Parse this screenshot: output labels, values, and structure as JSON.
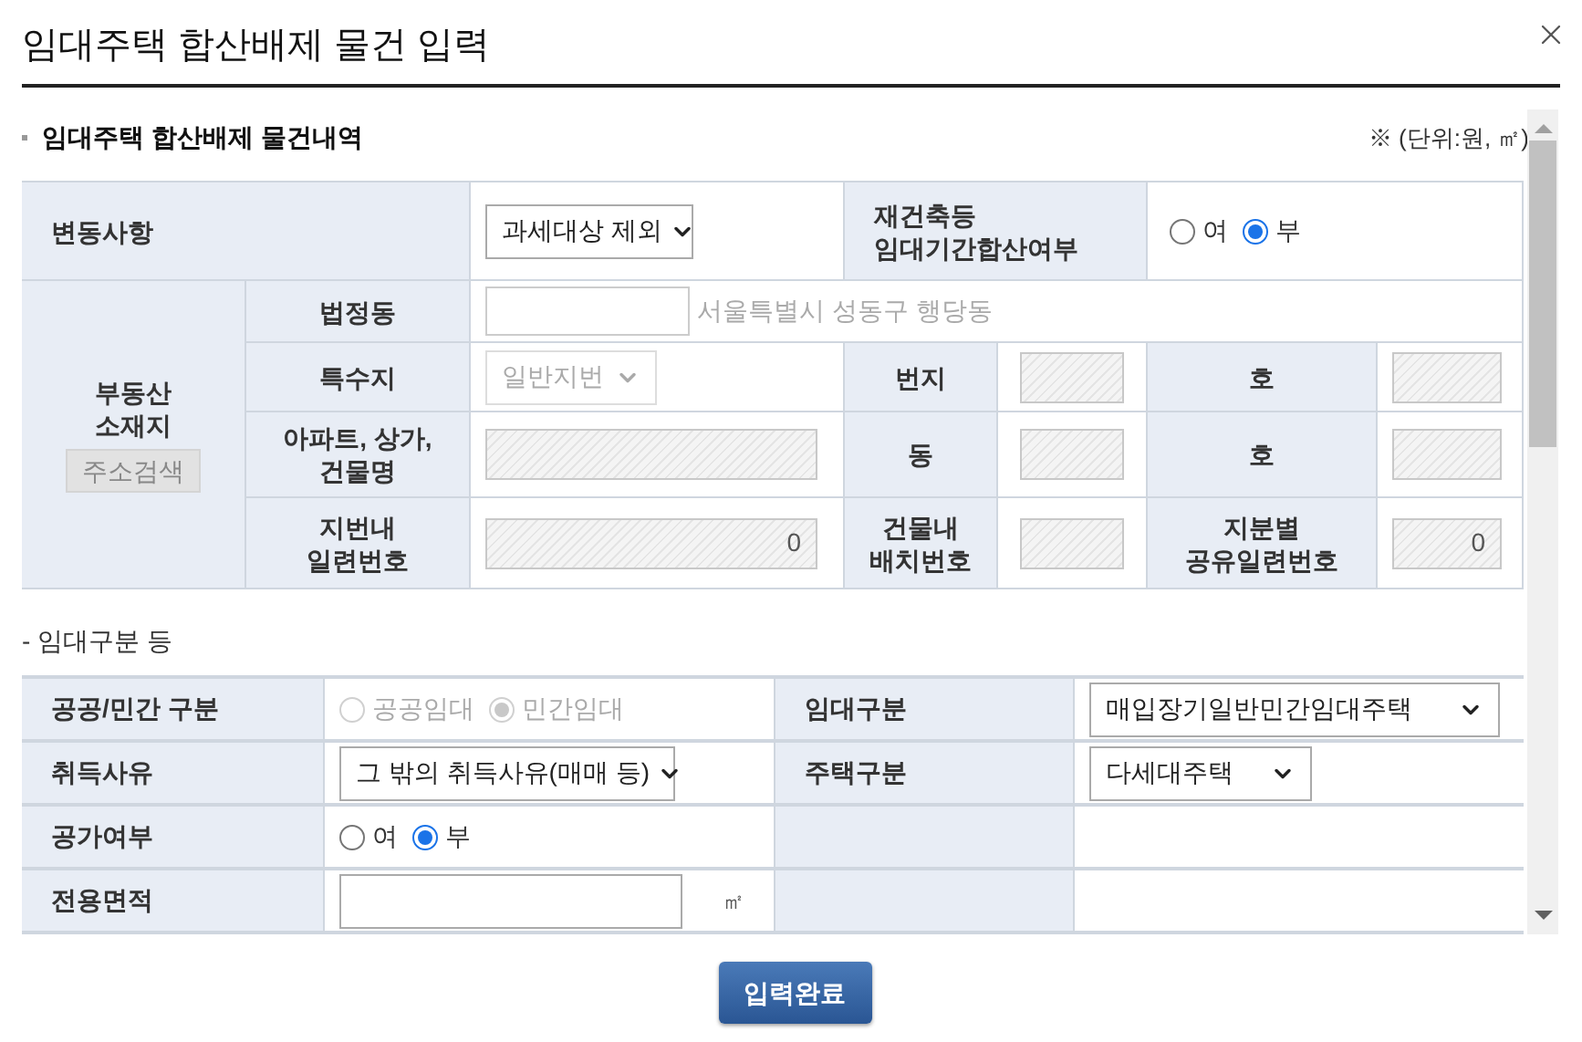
{
  "dialog": {
    "title": "임대주택 합산배제 물건 입력"
  },
  "section": {
    "title": "임대주택 합산배제 물건내역",
    "unit_note": "※ (단위:원, ㎡)"
  },
  "property_table": {
    "change": {
      "label": "변동사항",
      "value": "과세대상 제외"
    },
    "merge": {
      "label": "재건축등\n임대기간합산여부",
      "options": [
        {
          "label": "여",
          "selected": false
        },
        {
          "label": "부",
          "selected": true
        }
      ]
    },
    "location": {
      "label": "부동산\n소재지",
      "search_button": "주소검색"
    },
    "legal_dong": {
      "label": "법정동",
      "address": "서울특별시 성동구 행당동"
    },
    "special_lot": {
      "label": "특수지",
      "value": "일반지번",
      "disabled": true
    },
    "lot_number": {
      "label": "번지"
    },
    "lot_sub": {
      "label": "호"
    },
    "building_name": {
      "label": "아파트, 상가,\n건물명"
    },
    "building_dong": {
      "label": "동"
    },
    "building_ho": {
      "label": "호"
    },
    "lot_serial": {
      "label": "지번내\n일련번호",
      "value": "0"
    },
    "placement_number": {
      "label": "건물내\n배치번호"
    },
    "share_serial": {
      "label": "지분별\n공유일련번호",
      "value": "0"
    }
  },
  "rental_section": {
    "title": "- 임대구분 등",
    "rows": [
      [
        {
          "label": "공공/민간 구분",
          "kind": "radio",
          "disabled": true,
          "options": [
            {
              "label": "공공임대",
              "selected": false
            },
            {
              "label": "민간임대",
              "selected": true
            }
          ]
        },
        {
          "label": "임대구분",
          "kind": "select",
          "value": "매입장기일반민간임대주택"
        }
      ],
      [
        {
          "label": "취득사유",
          "kind": "select",
          "value": "그 밖의 취득사유(매매 등)"
        },
        {
          "label": "주택구분",
          "kind": "select",
          "value": "다세대주택"
        }
      ],
      [
        {
          "label": "공가여부",
          "kind": "radio",
          "disabled": false,
          "options": [
            {
              "label": "여",
              "selected": false
            },
            {
              "label": "부",
              "selected": true
            }
          ]
        },
        {
          "kind": "empty"
        }
      ],
      [
        {
          "label": "전용면적",
          "kind": "input",
          "unit": "㎡"
        },
        {
          "kind": "empty"
        }
      ]
    ]
  },
  "submit_button": "입력완료"
}
